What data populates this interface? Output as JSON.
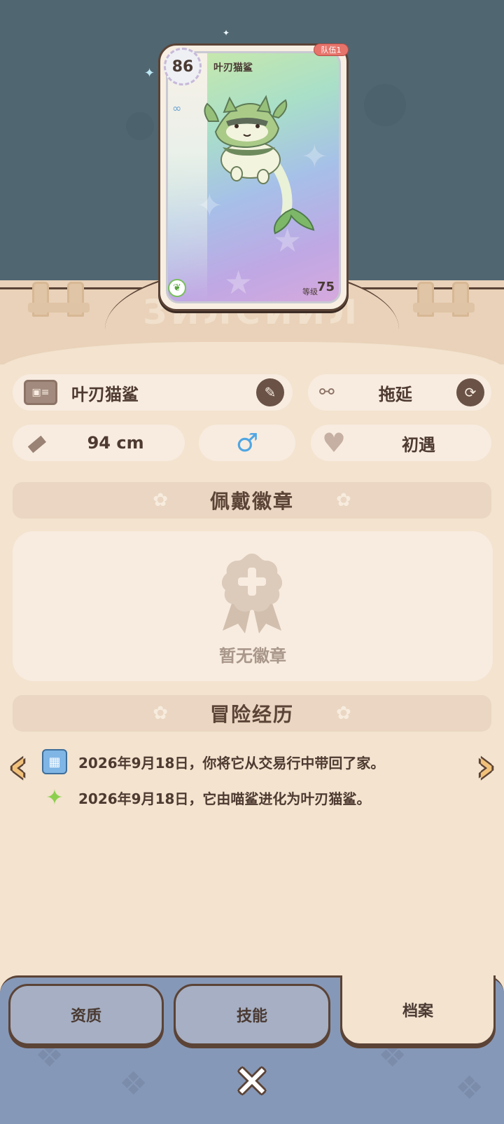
{
  "card": {
    "team_badge": "队伍1",
    "rating": "86",
    "name": "叶刃猫鲨",
    "level_label": "等级",
    "level_value": "75",
    "ghost_text": "ЗИЛСИИЛ"
  },
  "info": {
    "name": "叶刃猫鲨",
    "personality": "拖延",
    "height": "94 cm",
    "gender_symbol": "♂",
    "relationship": "初遇"
  },
  "badges": {
    "section_title": "佩戴徽章",
    "empty_text": "暂无徽章"
  },
  "history": {
    "section_title": "冒险经历",
    "items": [
      {
        "text": "2026年9月18日，你将它从交易行中带回了家。",
        "icon": "vending-machine-icon"
      },
      {
        "text": "2026年9月18日，它由喵鲨进化为叶刃猫鲨。",
        "icon": "evolve-star-icon"
      }
    ]
  },
  "tabs": [
    {
      "label": "资质",
      "active": false
    },
    {
      "label": "技能",
      "active": false
    },
    {
      "label": "档案",
      "active": true
    }
  ],
  "colors": {
    "accent_brown": "#5b4336",
    "panel": "#f8ece0",
    "background": "#f3e3cf",
    "team_badge": "#e7746b",
    "bottom_bar": "#8698b7"
  }
}
